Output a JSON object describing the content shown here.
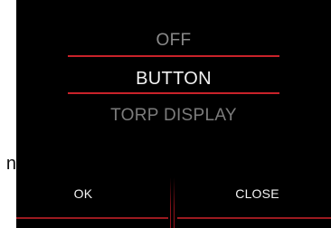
{
  "background": {
    "partial_letter": "n"
  },
  "picker": {
    "options": [
      "OFF",
      "BUTTON",
      "TORP DISPLAY"
    ],
    "selected": "BUTTON"
  },
  "buttons": {
    "ok_label": "OK",
    "close_label": "CLOSE"
  },
  "colors": {
    "dialog_background": "#000000",
    "accent_red": "#c8222a",
    "selected_text": "#f2f2f2",
    "unselected_text": "#8a8a8a"
  }
}
